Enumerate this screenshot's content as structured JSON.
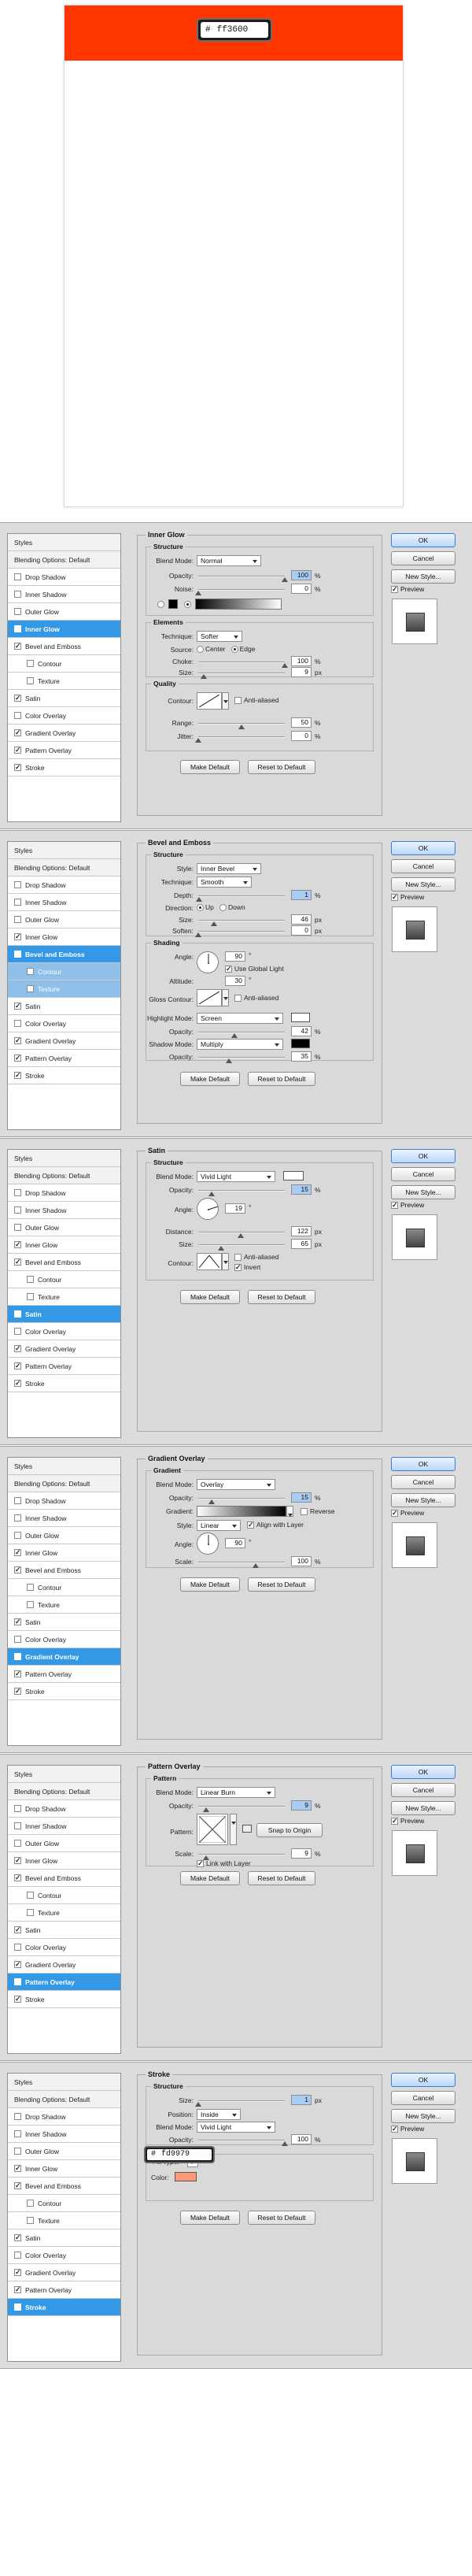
{
  "canvas": {
    "fill": "#ff3600",
    "hex_hash": "#",
    "hex_value": "ff3600"
  },
  "styles_items": [
    "Blending Options: Default",
    "Drop Shadow",
    "Inner Shadow",
    "Outer Glow",
    "Inner Glow",
    "Bevel and Emboss",
    "Contour",
    "Texture",
    "Satin",
    "Color Overlay",
    "Gradient Overlay",
    "Pattern Overlay",
    "Stroke"
  ],
  "styles_title": "Styles",
  "buttons": {
    "ok": "OK",
    "cancel": "Cancel",
    "new_style": "New Style...",
    "preview": "Preview",
    "make_default": "Make Default",
    "reset_default": "Reset to Default"
  },
  "common": {
    "blend_mode": "Blend Mode:",
    "opacity": "Opacity:",
    "size": "Size:",
    "percent": "%",
    "px": "px",
    "contour": "Contour:",
    "anti_aliased": "Anti-aliased",
    "structure": "Structure",
    "degree": "°"
  },
  "inner_glow": {
    "title": "Inner Glow",
    "blend_mode": "Normal",
    "opacity": "100",
    "noise_label": "Noise:",
    "noise": "0",
    "elements_title": "Elements",
    "technique_label": "Technique:",
    "technique": "Softer",
    "source_label": "Source:",
    "source_center": "Center",
    "source_edge": "Edge",
    "choke_label": "Choke:",
    "choke": "100",
    "size": "9",
    "quality_title": "Quality",
    "range_label": "Range:",
    "range": "50",
    "jitter_label": "Jitter:",
    "jitter": "0"
  },
  "bevel": {
    "title": "Bevel and Emboss",
    "style_label": "Style:",
    "style": "Inner Bevel",
    "technique_label": "Technique:",
    "technique": "Smooth",
    "depth_label": "Depth:",
    "depth": "1",
    "direction_label": "Direction:",
    "dir_up": "Up",
    "dir_down": "Down",
    "size": "46",
    "soften_label": "Soften:",
    "soften": "0",
    "shading_title": "Shading",
    "angle_label": "Angle:",
    "angle": "90",
    "global_light": "Use Global Light",
    "altitude_label": "Altitude:",
    "altitude": "30",
    "gloss_label": "Gloss Contour:",
    "highlight_label": "Highlight Mode:",
    "highlight_mode": "Screen",
    "highlight_opacity": "42",
    "shadow_label": "Shadow Mode:",
    "shadow_mode": "Multiply",
    "shadow_opacity": "35"
  },
  "satin": {
    "title": "Satin",
    "blend_mode": "Vivid Light",
    "opacity": "15",
    "angle_label": "Angle:",
    "angle": "19",
    "distance_label": "Distance:",
    "distance": "122",
    "size": "65",
    "invert": "Invert"
  },
  "gradient_overlay": {
    "title": "Gradient Overlay",
    "group_title": "Gradient",
    "blend_mode": "Overlay",
    "opacity": "15",
    "gradient_label": "Gradient:",
    "reverse": "Reverse",
    "style_label": "Style:",
    "style": "Linear",
    "align": "Align with Layer",
    "angle_label": "Angle:",
    "angle": "90",
    "scale_label": "Scale:",
    "scale": "100"
  },
  "pattern_overlay": {
    "title": "Pattern Overlay",
    "group_title": "Pattern",
    "blend_mode": "Linear Burn",
    "opacity": "9",
    "pattern_label": "Pattern:",
    "snap": "Snap to Origin",
    "scale_label": "Scale:",
    "scale": "9",
    "link": "Link with Layer"
  },
  "stroke": {
    "title": "Stroke",
    "size": "1",
    "position_label": "Position:",
    "position": "Inside",
    "blend_mode": "Vivid Light",
    "opacity": "100",
    "fill_label": "Fill Type:",
    "fill_type": "Color",
    "color_label": "Color:",
    "color": "#fd9979",
    "hex_hash": "#",
    "hex_value": "fd9979"
  },
  "colors": {
    "selected": "#3399e6",
    "glow_swatch_dark": "#000000",
    "shadow_black": "#000000",
    "highlight_white": "#ffffff",
    "satin_swatch": "#ffffff"
  }
}
